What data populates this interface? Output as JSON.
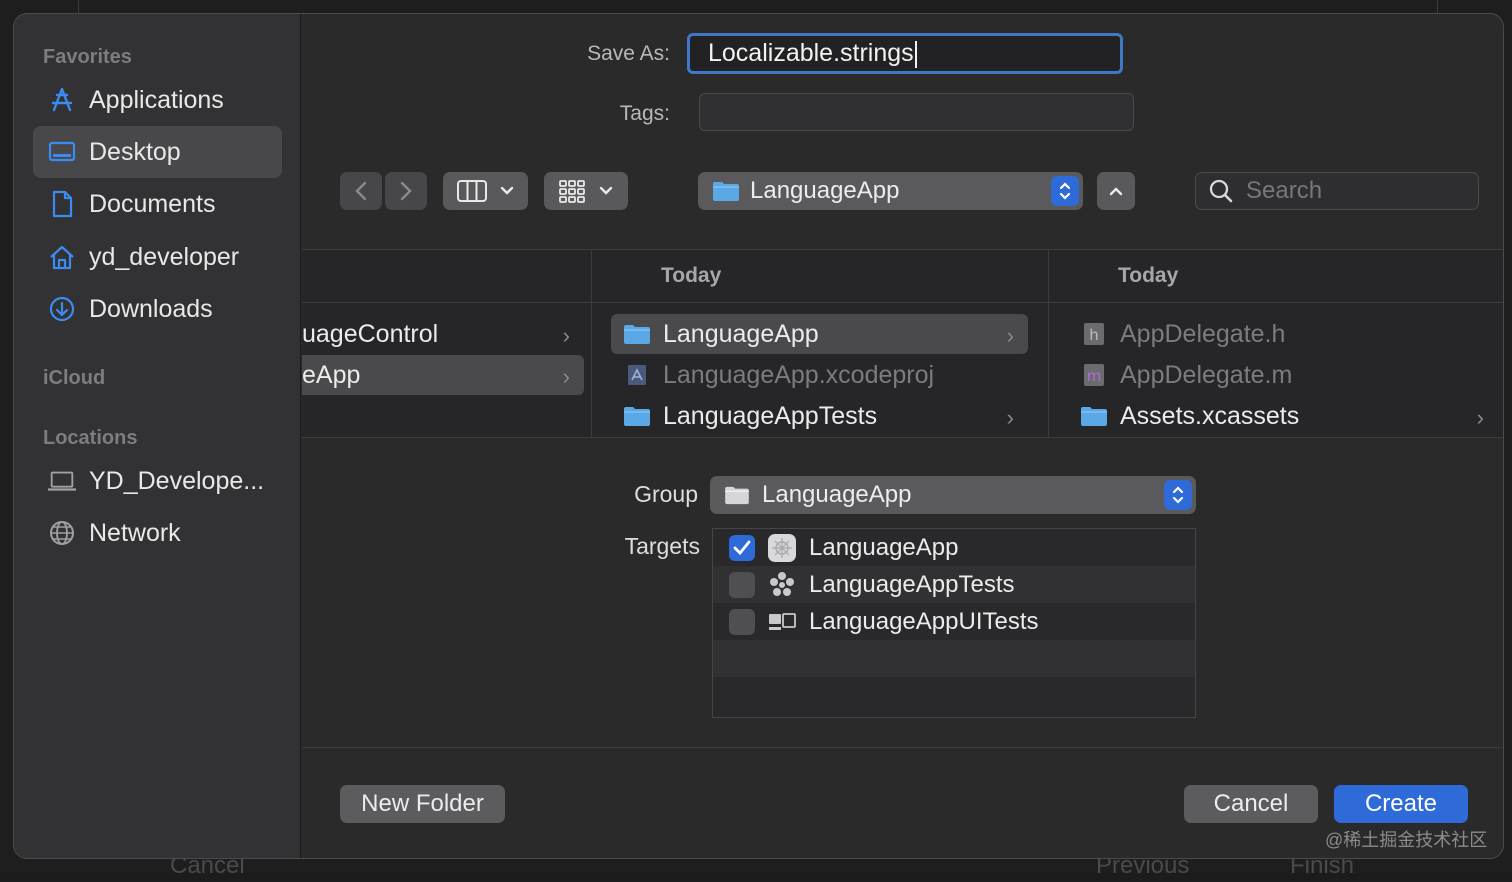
{
  "background": {
    "left_button_label": "Cancel",
    "previous_label": "Previous",
    "finish_label": "Finish"
  },
  "sidebar": {
    "favorites_title": "Favorites",
    "favorites": [
      {
        "label": "Applications",
        "icon": "applications-icon"
      },
      {
        "label": "Desktop",
        "icon": "desktop-icon",
        "selected": true
      },
      {
        "label": "Documents",
        "icon": "document-icon"
      },
      {
        "label": "yd_developer",
        "icon": "home-icon"
      },
      {
        "label": "Downloads",
        "icon": "download-icon"
      }
    ],
    "icloud_title": "iCloud",
    "locations_title": "Locations",
    "locations": [
      {
        "label": "YD_Develope...",
        "icon": "laptop-icon"
      },
      {
        "label": "Network",
        "icon": "globe-icon"
      }
    ]
  },
  "form": {
    "save_as_label": "Save As:",
    "save_as_value": "Localizable.strings",
    "tags_label": "Tags:",
    "tags_value": ""
  },
  "toolbar": {
    "location": "LanguageApp",
    "search_placeholder": "Search"
  },
  "browser": {
    "col1": [
      "uageControl",
      "eApp"
    ],
    "col2_header": "Today",
    "col2": [
      "LanguageApp",
      "LanguageApp.xcodeproj",
      "LanguageAppTests"
    ],
    "col3_header": "Today",
    "col3": [
      "AppDelegate.h",
      "AppDelegate.m",
      "Assets.xcassets"
    ]
  },
  "options": {
    "group_label": "Group",
    "group_value": "LanguageApp",
    "targets_label": "Targets",
    "targets": [
      {
        "label": "LanguageApp",
        "checked": true
      },
      {
        "label": "LanguageAppTests",
        "checked": false
      },
      {
        "label": "LanguageAppUITests",
        "checked": false
      }
    ]
  },
  "footer": {
    "new_folder": "New Folder",
    "cancel": "Cancel",
    "create": "Create"
  },
  "watermark": "@稀土掘金技术社区",
  "colors": {
    "accent": "#2f6bd8",
    "focus_ring": "#3f78c7",
    "folder": "#5aa9e6"
  }
}
